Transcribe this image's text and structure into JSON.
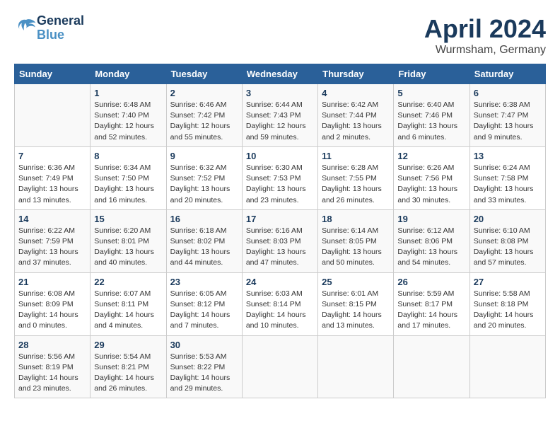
{
  "header": {
    "logo_line1": "General",
    "logo_line2": "Blue",
    "month": "April 2024",
    "location": "Wurmsham, Germany"
  },
  "days_of_week": [
    "Sunday",
    "Monday",
    "Tuesday",
    "Wednesday",
    "Thursday",
    "Friday",
    "Saturday"
  ],
  "weeks": [
    [
      {
        "day": "",
        "content": ""
      },
      {
        "day": "1",
        "content": "Sunrise: 6:48 AM\nSunset: 7:40 PM\nDaylight: 12 hours\nand 52 minutes."
      },
      {
        "day": "2",
        "content": "Sunrise: 6:46 AM\nSunset: 7:42 PM\nDaylight: 12 hours\nand 55 minutes."
      },
      {
        "day": "3",
        "content": "Sunrise: 6:44 AM\nSunset: 7:43 PM\nDaylight: 12 hours\nand 59 minutes."
      },
      {
        "day": "4",
        "content": "Sunrise: 6:42 AM\nSunset: 7:44 PM\nDaylight: 13 hours\nand 2 minutes."
      },
      {
        "day": "5",
        "content": "Sunrise: 6:40 AM\nSunset: 7:46 PM\nDaylight: 13 hours\nand 6 minutes."
      },
      {
        "day": "6",
        "content": "Sunrise: 6:38 AM\nSunset: 7:47 PM\nDaylight: 13 hours\nand 9 minutes."
      }
    ],
    [
      {
        "day": "7",
        "content": "Sunrise: 6:36 AM\nSunset: 7:49 PM\nDaylight: 13 hours\nand 13 minutes."
      },
      {
        "day": "8",
        "content": "Sunrise: 6:34 AM\nSunset: 7:50 PM\nDaylight: 13 hours\nand 16 minutes."
      },
      {
        "day": "9",
        "content": "Sunrise: 6:32 AM\nSunset: 7:52 PM\nDaylight: 13 hours\nand 20 minutes."
      },
      {
        "day": "10",
        "content": "Sunrise: 6:30 AM\nSunset: 7:53 PM\nDaylight: 13 hours\nand 23 minutes."
      },
      {
        "day": "11",
        "content": "Sunrise: 6:28 AM\nSunset: 7:55 PM\nDaylight: 13 hours\nand 26 minutes."
      },
      {
        "day": "12",
        "content": "Sunrise: 6:26 AM\nSunset: 7:56 PM\nDaylight: 13 hours\nand 30 minutes."
      },
      {
        "day": "13",
        "content": "Sunrise: 6:24 AM\nSunset: 7:58 PM\nDaylight: 13 hours\nand 33 minutes."
      }
    ],
    [
      {
        "day": "14",
        "content": "Sunrise: 6:22 AM\nSunset: 7:59 PM\nDaylight: 13 hours\nand 37 minutes."
      },
      {
        "day": "15",
        "content": "Sunrise: 6:20 AM\nSunset: 8:01 PM\nDaylight: 13 hours\nand 40 minutes."
      },
      {
        "day": "16",
        "content": "Sunrise: 6:18 AM\nSunset: 8:02 PM\nDaylight: 13 hours\nand 44 minutes."
      },
      {
        "day": "17",
        "content": "Sunrise: 6:16 AM\nSunset: 8:03 PM\nDaylight: 13 hours\nand 47 minutes."
      },
      {
        "day": "18",
        "content": "Sunrise: 6:14 AM\nSunset: 8:05 PM\nDaylight: 13 hours\nand 50 minutes."
      },
      {
        "day": "19",
        "content": "Sunrise: 6:12 AM\nSunset: 8:06 PM\nDaylight: 13 hours\nand 54 minutes."
      },
      {
        "day": "20",
        "content": "Sunrise: 6:10 AM\nSunset: 8:08 PM\nDaylight: 13 hours\nand 57 minutes."
      }
    ],
    [
      {
        "day": "21",
        "content": "Sunrise: 6:08 AM\nSunset: 8:09 PM\nDaylight: 14 hours\nand 0 minutes."
      },
      {
        "day": "22",
        "content": "Sunrise: 6:07 AM\nSunset: 8:11 PM\nDaylight: 14 hours\nand 4 minutes."
      },
      {
        "day": "23",
        "content": "Sunrise: 6:05 AM\nSunset: 8:12 PM\nDaylight: 14 hours\nand 7 minutes."
      },
      {
        "day": "24",
        "content": "Sunrise: 6:03 AM\nSunset: 8:14 PM\nDaylight: 14 hours\nand 10 minutes."
      },
      {
        "day": "25",
        "content": "Sunrise: 6:01 AM\nSunset: 8:15 PM\nDaylight: 14 hours\nand 13 minutes."
      },
      {
        "day": "26",
        "content": "Sunrise: 5:59 AM\nSunset: 8:17 PM\nDaylight: 14 hours\nand 17 minutes."
      },
      {
        "day": "27",
        "content": "Sunrise: 5:58 AM\nSunset: 8:18 PM\nDaylight: 14 hours\nand 20 minutes."
      }
    ],
    [
      {
        "day": "28",
        "content": "Sunrise: 5:56 AM\nSunset: 8:19 PM\nDaylight: 14 hours\nand 23 minutes."
      },
      {
        "day": "29",
        "content": "Sunrise: 5:54 AM\nSunset: 8:21 PM\nDaylight: 14 hours\nand 26 minutes."
      },
      {
        "day": "30",
        "content": "Sunrise: 5:53 AM\nSunset: 8:22 PM\nDaylight: 14 hours\nand 29 minutes."
      },
      {
        "day": "",
        "content": ""
      },
      {
        "day": "",
        "content": ""
      },
      {
        "day": "",
        "content": ""
      },
      {
        "day": "",
        "content": ""
      }
    ]
  ]
}
